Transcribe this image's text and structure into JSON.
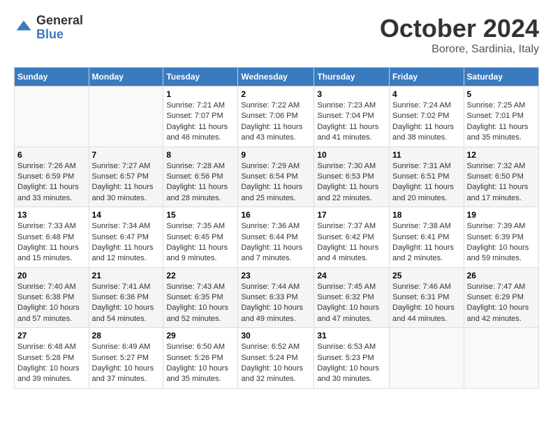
{
  "logo": {
    "general": "General",
    "blue": "Blue"
  },
  "title": "October 2024",
  "location": "Borore, Sardinia, Italy",
  "days_of_week": [
    "Sunday",
    "Monday",
    "Tuesday",
    "Wednesday",
    "Thursday",
    "Friday",
    "Saturday"
  ],
  "weeks": [
    [
      {
        "day": "",
        "sunrise": "",
        "sunset": "",
        "daylight": ""
      },
      {
        "day": "",
        "sunrise": "",
        "sunset": "",
        "daylight": ""
      },
      {
        "day": "1",
        "sunrise": "Sunrise: 7:21 AM",
        "sunset": "Sunset: 7:07 PM",
        "daylight": "Daylight: 11 hours and 46 minutes."
      },
      {
        "day": "2",
        "sunrise": "Sunrise: 7:22 AM",
        "sunset": "Sunset: 7:06 PM",
        "daylight": "Daylight: 11 hours and 43 minutes."
      },
      {
        "day": "3",
        "sunrise": "Sunrise: 7:23 AM",
        "sunset": "Sunset: 7:04 PM",
        "daylight": "Daylight: 11 hours and 41 minutes."
      },
      {
        "day": "4",
        "sunrise": "Sunrise: 7:24 AM",
        "sunset": "Sunset: 7:02 PM",
        "daylight": "Daylight: 11 hours and 38 minutes."
      },
      {
        "day": "5",
        "sunrise": "Sunrise: 7:25 AM",
        "sunset": "Sunset: 7:01 PM",
        "daylight": "Daylight: 11 hours and 35 minutes."
      }
    ],
    [
      {
        "day": "6",
        "sunrise": "Sunrise: 7:26 AM",
        "sunset": "Sunset: 6:59 PM",
        "daylight": "Daylight: 11 hours and 33 minutes."
      },
      {
        "day": "7",
        "sunrise": "Sunrise: 7:27 AM",
        "sunset": "Sunset: 6:57 PM",
        "daylight": "Daylight: 11 hours and 30 minutes."
      },
      {
        "day": "8",
        "sunrise": "Sunrise: 7:28 AM",
        "sunset": "Sunset: 6:56 PM",
        "daylight": "Daylight: 11 hours and 28 minutes."
      },
      {
        "day": "9",
        "sunrise": "Sunrise: 7:29 AM",
        "sunset": "Sunset: 6:54 PM",
        "daylight": "Daylight: 11 hours and 25 minutes."
      },
      {
        "day": "10",
        "sunrise": "Sunrise: 7:30 AM",
        "sunset": "Sunset: 6:53 PM",
        "daylight": "Daylight: 11 hours and 22 minutes."
      },
      {
        "day": "11",
        "sunrise": "Sunrise: 7:31 AM",
        "sunset": "Sunset: 6:51 PM",
        "daylight": "Daylight: 11 hours and 20 minutes."
      },
      {
        "day": "12",
        "sunrise": "Sunrise: 7:32 AM",
        "sunset": "Sunset: 6:50 PM",
        "daylight": "Daylight: 11 hours and 17 minutes."
      }
    ],
    [
      {
        "day": "13",
        "sunrise": "Sunrise: 7:33 AM",
        "sunset": "Sunset: 6:48 PM",
        "daylight": "Daylight: 11 hours and 15 minutes."
      },
      {
        "day": "14",
        "sunrise": "Sunrise: 7:34 AM",
        "sunset": "Sunset: 6:47 PM",
        "daylight": "Daylight: 11 hours and 12 minutes."
      },
      {
        "day": "15",
        "sunrise": "Sunrise: 7:35 AM",
        "sunset": "Sunset: 6:45 PM",
        "daylight": "Daylight: 11 hours and 9 minutes."
      },
      {
        "day": "16",
        "sunrise": "Sunrise: 7:36 AM",
        "sunset": "Sunset: 6:44 PM",
        "daylight": "Daylight: 11 hours and 7 minutes."
      },
      {
        "day": "17",
        "sunrise": "Sunrise: 7:37 AM",
        "sunset": "Sunset: 6:42 PM",
        "daylight": "Daylight: 11 hours and 4 minutes."
      },
      {
        "day": "18",
        "sunrise": "Sunrise: 7:38 AM",
        "sunset": "Sunset: 6:41 PM",
        "daylight": "Daylight: 11 hours and 2 minutes."
      },
      {
        "day": "19",
        "sunrise": "Sunrise: 7:39 AM",
        "sunset": "Sunset: 6:39 PM",
        "daylight": "Daylight: 10 hours and 59 minutes."
      }
    ],
    [
      {
        "day": "20",
        "sunrise": "Sunrise: 7:40 AM",
        "sunset": "Sunset: 6:38 PM",
        "daylight": "Daylight: 10 hours and 57 minutes."
      },
      {
        "day": "21",
        "sunrise": "Sunrise: 7:41 AM",
        "sunset": "Sunset: 6:36 PM",
        "daylight": "Daylight: 10 hours and 54 minutes."
      },
      {
        "day": "22",
        "sunrise": "Sunrise: 7:43 AM",
        "sunset": "Sunset: 6:35 PM",
        "daylight": "Daylight: 10 hours and 52 minutes."
      },
      {
        "day": "23",
        "sunrise": "Sunrise: 7:44 AM",
        "sunset": "Sunset: 6:33 PM",
        "daylight": "Daylight: 10 hours and 49 minutes."
      },
      {
        "day": "24",
        "sunrise": "Sunrise: 7:45 AM",
        "sunset": "Sunset: 6:32 PM",
        "daylight": "Daylight: 10 hours and 47 minutes."
      },
      {
        "day": "25",
        "sunrise": "Sunrise: 7:46 AM",
        "sunset": "Sunset: 6:31 PM",
        "daylight": "Daylight: 10 hours and 44 minutes."
      },
      {
        "day": "26",
        "sunrise": "Sunrise: 7:47 AM",
        "sunset": "Sunset: 6:29 PM",
        "daylight": "Daylight: 10 hours and 42 minutes."
      }
    ],
    [
      {
        "day": "27",
        "sunrise": "Sunrise: 6:48 AM",
        "sunset": "Sunset: 5:28 PM",
        "daylight": "Daylight: 10 hours and 39 minutes."
      },
      {
        "day": "28",
        "sunrise": "Sunrise: 6:49 AM",
        "sunset": "Sunset: 5:27 PM",
        "daylight": "Daylight: 10 hours and 37 minutes."
      },
      {
        "day": "29",
        "sunrise": "Sunrise: 6:50 AM",
        "sunset": "Sunset: 5:26 PM",
        "daylight": "Daylight: 10 hours and 35 minutes."
      },
      {
        "day": "30",
        "sunrise": "Sunrise: 6:52 AM",
        "sunset": "Sunset: 5:24 PM",
        "daylight": "Daylight: 10 hours and 32 minutes."
      },
      {
        "day": "31",
        "sunrise": "Sunrise: 6:53 AM",
        "sunset": "Sunset: 5:23 PM",
        "daylight": "Daylight: 10 hours and 30 minutes."
      },
      {
        "day": "",
        "sunrise": "",
        "sunset": "",
        "daylight": ""
      },
      {
        "day": "",
        "sunrise": "",
        "sunset": "",
        "daylight": ""
      }
    ]
  ]
}
